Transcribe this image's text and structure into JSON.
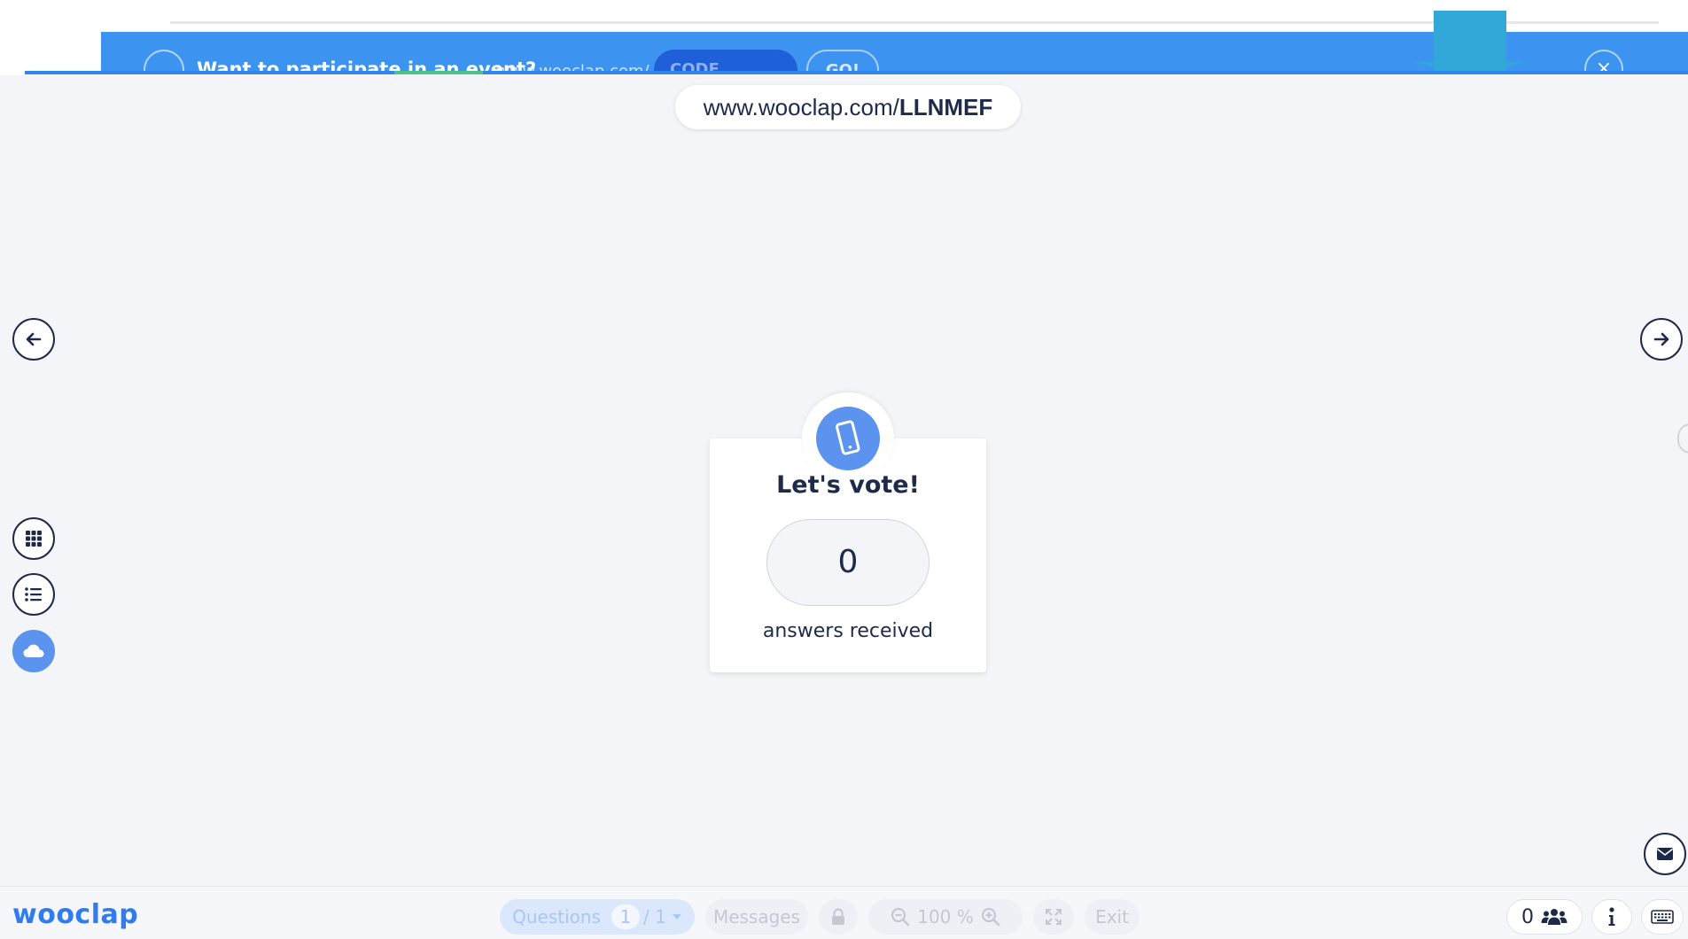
{
  "banner": {
    "text": "Want to participate in an event?",
    "url": "www.wooclap.com/",
    "code_placeholder": "CODE",
    "go_label": "GO!",
    "close_glyph": "×"
  },
  "event_url": {
    "prefix": "www.wooclap.com/",
    "code": "LLNMEF"
  },
  "card": {
    "title": "Let's vote!",
    "count": "0",
    "label": "answers received"
  },
  "bottom_bar": {
    "logo": "wooclap",
    "questions_label": "Questions",
    "question_current": "1",
    "question_total": "/ 1",
    "messages_label": "Messages",
    "zoom_value": "100 %",
    "exit_label": "Exit",
    "participants_count": "0"
  },
  "colors": {
    "brand_blue": "#2f7cf0",
    "accent_blue": "#5b93ee",
    "banner_blue": "#3d93f0",
    "text_navy": "#1e2a4a"
  }
}
